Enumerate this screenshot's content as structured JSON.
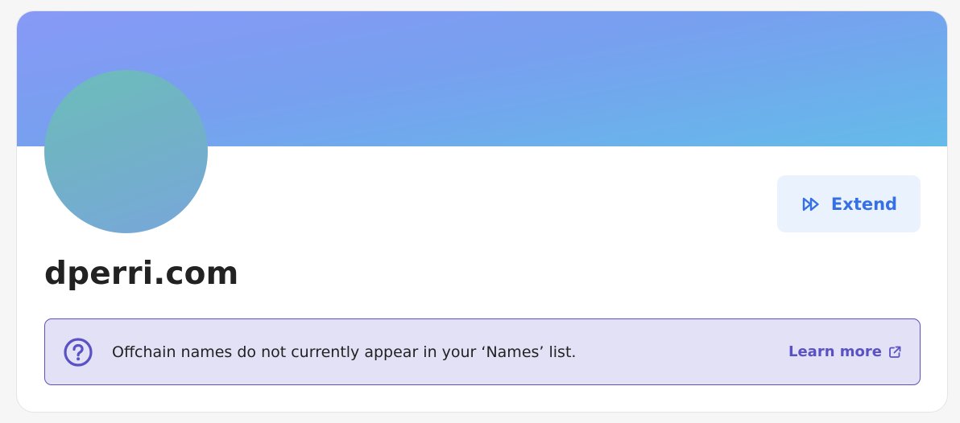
{
  "profile": {
    "name": "dperri.com"
  },
  "actions": {
    "extend_label": "Extend",
    "extend_icon": "fast-forward-icon"
  },
  "notice": {
    "icon": "question-circle-icon",
    "message": "Offchain names do not currently appear in your ‘Names’ list.",
    "link_label": "Learn more",
    "link_icon": "external-link-icon"
  },
  "colors": {
    "banner_start": "#8799f6",
    "banner_end": "#64bbe9",
    "avatar_start": "#6cbdbb",
    "avatar_end": "#78a7da",
    "accent_blue": "#3770e3",
    "extend_bg": "#eaf2fe",
    "notice_bg": "#e3e1f6",
    "notice_accent": "#5a52c4"
  }
}
